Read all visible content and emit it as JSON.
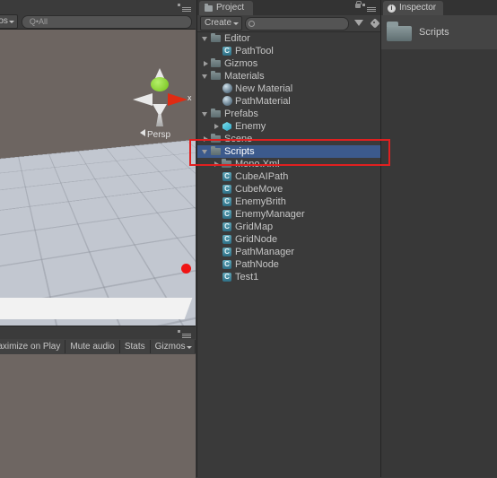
{
  "scene_view": {
    "tabstrip_menu_icon": "hamburger-menu-icon",
    "gizmos_dropdown_label": "mos",
    "search_placeholder": "Q•All",
    "search_value": "Q•All",
    "gizmo": {
      "x_axis_label": "x",
      "projection_label": "Persp"
    }
  },
  "game_view": {
    "tabstrip_menu_icon": "hamburger-menu-icon",
    "toolbar": [
      {
        "label": "Maximize on Play",
        "type": "toggle"
      },
      {
        "label": "Mute audio",
        "type": "toggle"
      },
      {
        "label": "Stats",
        "type": "toggle"
      },
      {
        "label": "Gizmos",
        "type": "dropdown"
      }
    ]
  },
  "project": {
    "tab_label": "Project",
    "lock_icon": "lock-icon",
    "menu_icon": "hamburger-menu-icon",
    "create_label": "Create",
    "search_value": "",
    "search_placeholder": "",
    "filter_icon": "filter-icon",
    "tag_icon": "tag-icon",
    "tree": [
      {
        "label": "Editor",
        "icon": "folder",
        "indent": 0,
        "arrow": "open",
        "selected": false
      },
      {
        "label": "PathTool",
        "icon": "cs",
        "indent": 1,
        "arrow": "none",
        "selected": false
      },
      {
        "label": "Gizmos",
        "icon": "folder",
        "indent": 0,
        "arrow": "closed",
        "selected": false
      },
      {
        "label": "Materials",
        "icon": "folder",
        "indent": 0,
        "arrow": "open",
        "selected": false
      },
      {
        "label": "New Material",
        "icon": "mat",
        "indent": 1,
        "arrow": "none",
        "selected": false
      },
      {
        "label": "PathMaterial",
        "icon": "mat",
        "indent": 1,
        "arrow": "none",
        "selected": false
      },
      {
        "label": "Prefabs",
        "icon": "folder",
        "indent": 0,
        "arrow": "open",
        "selected": false
      },
      {
        "label": "Enemy",
        "icon": "prefab",
        "indent": 1,
        "arrow": "closed",
        "selected": false
      },
      {
        "label": "Scene",
        "icon": "folder",
        "indent": 0,
        "arrow": "closed",
        "selected": false
      },
      {
        "label": "Scripts",
        "icon": "folder",
        "indent": 0,
        "arrow": "open",
        "selected": true
      },
      {
        "label": "Mono.Xml",
        "icon": "folder",
        "indent": 1,
        "arrow": "closed",
        "selected": false
      },
      {
        "label": "CubeAIPath",
        "icon": "cs",
        "indent": 1,
        "arrow": "none",
        "selected": false
      },
      {
        "label": "CubeMove",
        "icon": "cs",
        "indent": 1,
        "arrow": "none",
        "selected": false
      },
      {
        "label": "EnemyBrith",
        "icon": "cs",
        "indent": 1,
        "arrow": "none",
        "selected": false
      },
      {
        "label": "EnemyManager",
        "icon": "cs",
        "indent": 1,
        "arrow": "none",
        "selected": false
      },
      {
        "label": "GridMap",
        "icon": "cs",
        "indent": 1,
        "arrow": "none",
        "selected": false
      },
      {
        "label": "GridNode",
        "icon": "cs",
        "indent": 1,
        "arrow": "none",
        "selected": false
      },
      {
        "label": "PathManager",
        "icon": "cs",
        "indent": 1,
        "arrow": "none",
        "selected": false
      },
      {
        "label": "PathNode",
        "icon": "cs",
        "indent": 1,
        "arrow": "none",
        "selected": false
      },
      {
        "label": "Test1",
        "icon": "cs",
        "indent": 1,
        "arrow": "none",
        "selected": false
      }
    ]
  },
  "inspector": {
    "tab_label": "Inspector",
    "info_icon_glyph": "i",
    "selected_asset_name": "Scripts",
    "selected_asset_icon": "folder-icon"
  },
  "colors": {
    "panel_background": "#3a3a3a",
    "tabstrip_background": "#333333",
    "selection_blue": "#3c5a8c",
    "annotation_red": "#e02020",
    "scene_background": "#6d6561",
    "game_background": "#6e6662",
    "text": "#c6c6c6",
    "script_icon": "#2e6f86",
    "marker_dot_red": "#f01414",
    "gizmo_y_green": "#73c018",
    "gizmo_x_red": "#e02b12"
  }
}
